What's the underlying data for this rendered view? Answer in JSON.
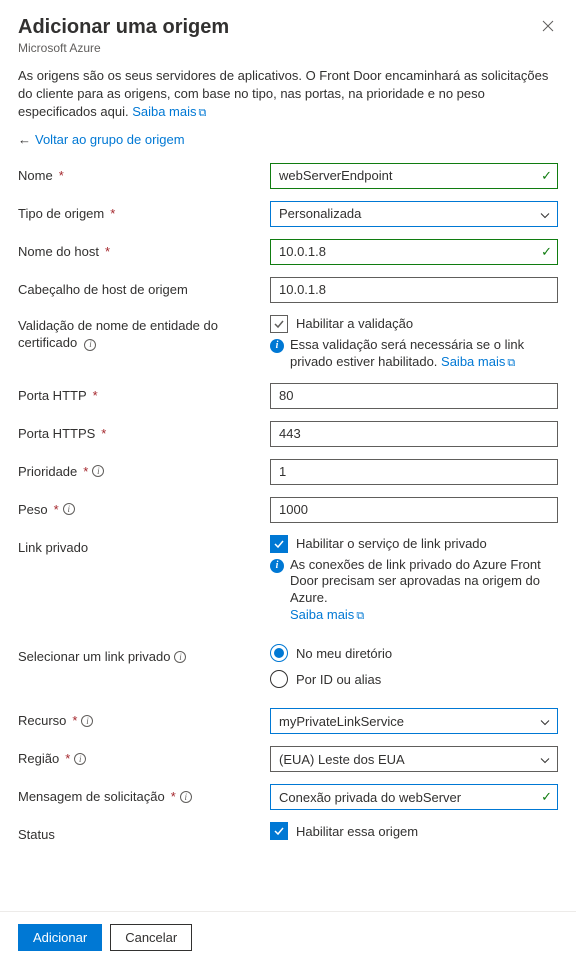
{
  "header": {
    "title": "Adicionar uma origem",
    "subtitle": "Microsoft Azure"
  },
  "description": {
    "text": "As origens são os seus servidores de aplicativos. O Front Door encaminhará as solicitações do cliente para as origens, com base no tipo, nas portas, na prioridade e no peso especificados aqui. ",
    "learn_more": "Saiba mais"
  },
  "back_link": "Voltar ao grupo de origem",
  "fields": {
    "name": {
      "label": "Nome",
      "value": "webServerEndpoint"
    },
    "origin_type": {
      "label": "Tipo de origem",
      "value": "Personalizada"
    },
    "host_name": {
      "label": "Nome do host",
      "value": "10.0.1.8"
    },
    "origin_host_header": {
      "label": "Cabeçalho de host de origem",
      "value": "10.0.1.8"
    },
    "cert_validation": {
      "label": "Validação de nome de entidade do certificado",
      "checkbox_label": "Habilitar a validação",
      "note": "Essa validação será necessária se o link privado estiver habilitado. ",
      "learn_more": "Saiba mais"
    },
    "http_port": {
      "label": "Porta HTTP",
      "value": "80"
    },
    "https_port": {
      "label": "Porta HTTPS",
      "value": "443"
    },
    "priority": {
      "label": "Prioridade",
      "value": "1"
    },
    "weight": {
      "label": "Peso",
      "value": "1000"
    },
    "private_link": {
      "label": "Link privado",
      "checkbox_label": "Habilitar o serviço de link privado",
      "note": "As conexões de link privado do Azure Front Door precisam ser aprovadas na origem do Azure.",
      "learn_more": "Saiba mais"
    },
    "select_private_link": {
      "label": "Selecionar um link privado",
      "options": {
        "in_directory": "No meu diretório",
        "by_id": "Por ID ou alias"
      }
    },
    "resource": {
      "label": "Recurso",
      "value": "myPrivateLinkService"
    },
    "region": {
      "label": "Região",
      "value": "(EUA) Leste dos EUA"
    },
    "request_message": {
      "label": "Mensagem de solicitação",
      "value": "Conexão privada do webServer"
    },
    "status": {
      "label": "Status",
      "checkbox_label": "Habilitar essa origem"
    }
  },
  "footer": {
    "add": "Adicionar",
    "cancel": "Cancelar"
  }
}
